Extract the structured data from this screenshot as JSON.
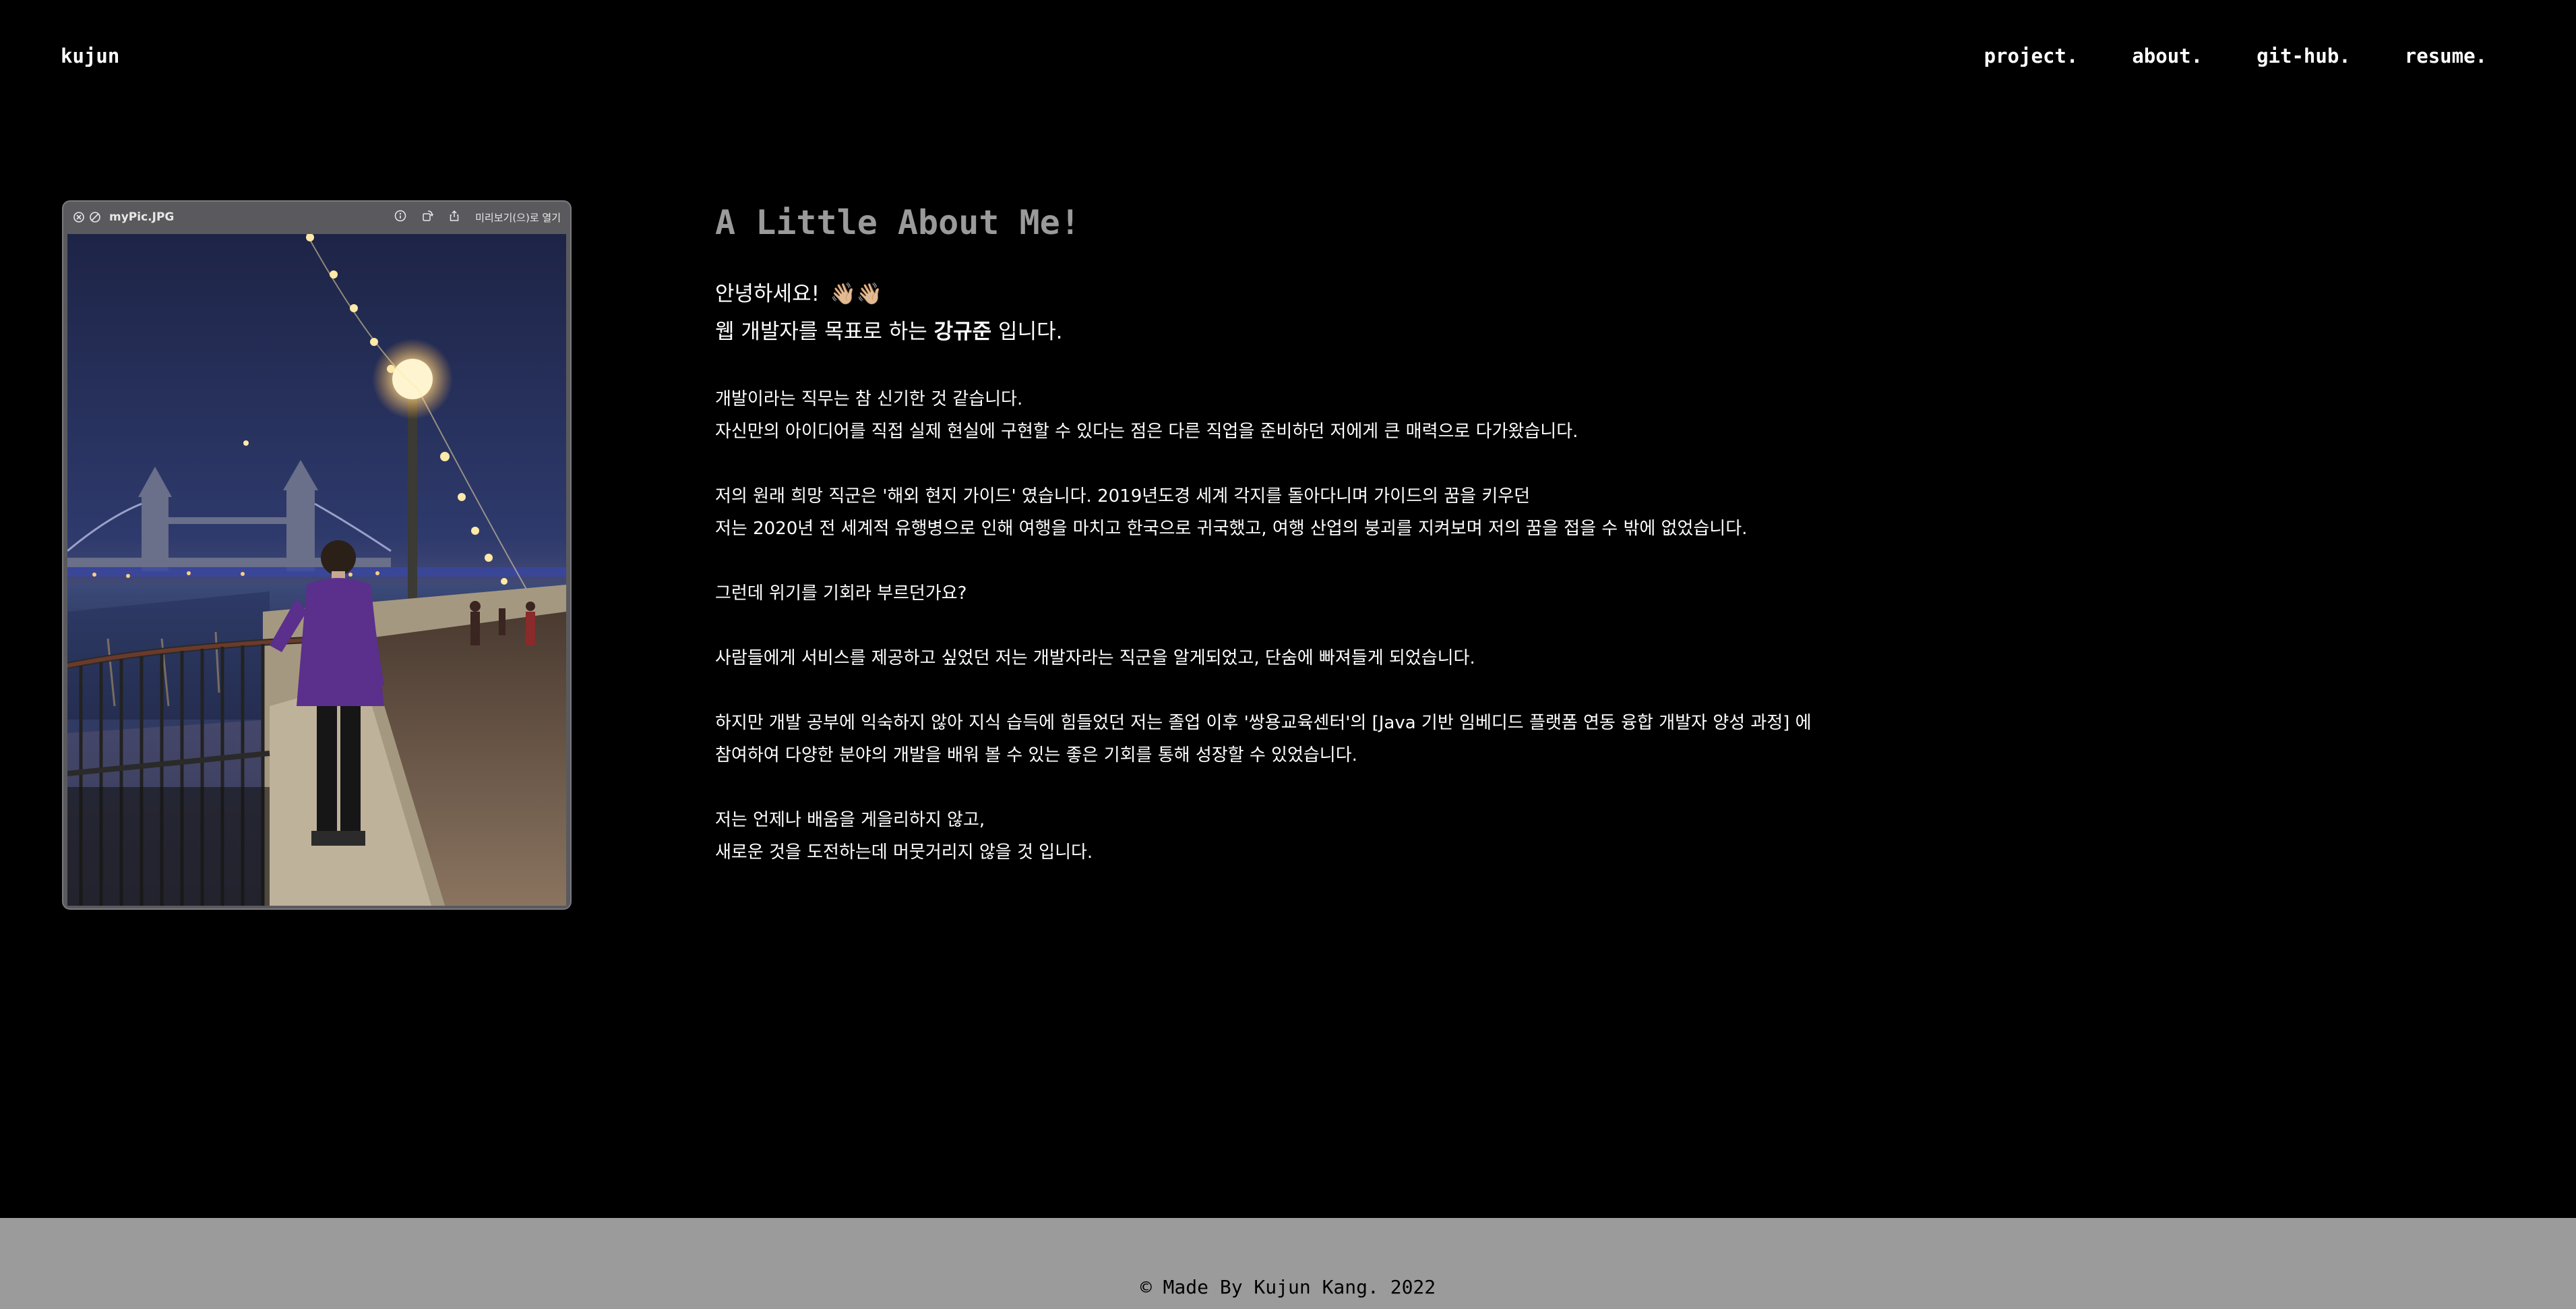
{
  "nav": {
    "logo": "kujun",
    "links": [
      "project.",
      "about.",
      "git-hub.",
      "resume."
    ]
  },
  "preview": {
    "filename": "myPic.JPG",
    "open_label": "미리보기(으)로 열기",
    "icons": [
      "close-icon",
      "block-icon",
      "info-icon",
      "rotate-icon",
      "share-icon"
    ]
  },
  "about": {
    "title": "A Little About Me!",
    "greeting_line1": "안녕하세요!",
    "greeting_emoji": "👋🏼👋🏼",
    "greeting_line2_prefix": "웹 개발자를 목표로 하는",
    "greeting_name": "강규준",
    "greeting_line2_suffix": "입니다.",
    "paragraphs": [
      [
        "개발이라는 직무는 참 신기한 것 같습니다.",
        "자신만의 아이디어를 직접 실제 현실에 구현할 수 있다는 점은 다른 직업을 준비하던 저에게 큰 매력으로 다가왔습니다."
      ],
      [
        "저의 원래 희망 직군은 '해외 현지 가이드' 였습니다.  2019년도경 세계 각지를 돌아다니며 가이드의 꿈을 키우던",
        "저는 2020년 전 세계적 유행병으로 인해 여행을 마치고 한국으로 귀국했고, 여행 산업의 붕괴를 지켜보며 저의 꿈을 접을 수 밖에 없었습니다."
      ],
      [
        "그런데 위기를 기회라 부르던가요?"
      ],
      [
        "사람들에게 서비스를 제공하고 싶었던 저는 개발자라는 직군을 알게되었고, 단숨에 빠져들게 되었습니다."
      ],
      [
        "하지만 개발 공부에 익숙하지 않아 지식 습득에 힘들었던 저는 졸업 이후 '쌍용교육센터'의 [Java 기반 임베디드 플랫폼 연동 융합 개발자 양성 과정] 에",
        "참여하여 다양한 분야의 개발을 배워 볼 수 있는 좋은 기회를 통해 성장할 수 있었습니다."
      ],
      [
        "저는 언제나 배움을 게을리하지 않고,",
        "새로운 것을 도전하는데 머뭇거리지 않을 것 입니다."
      ]
    ]
  },
  "footer": {
    "text": "© Made By Kujun Kang. 2022"
  }
}
